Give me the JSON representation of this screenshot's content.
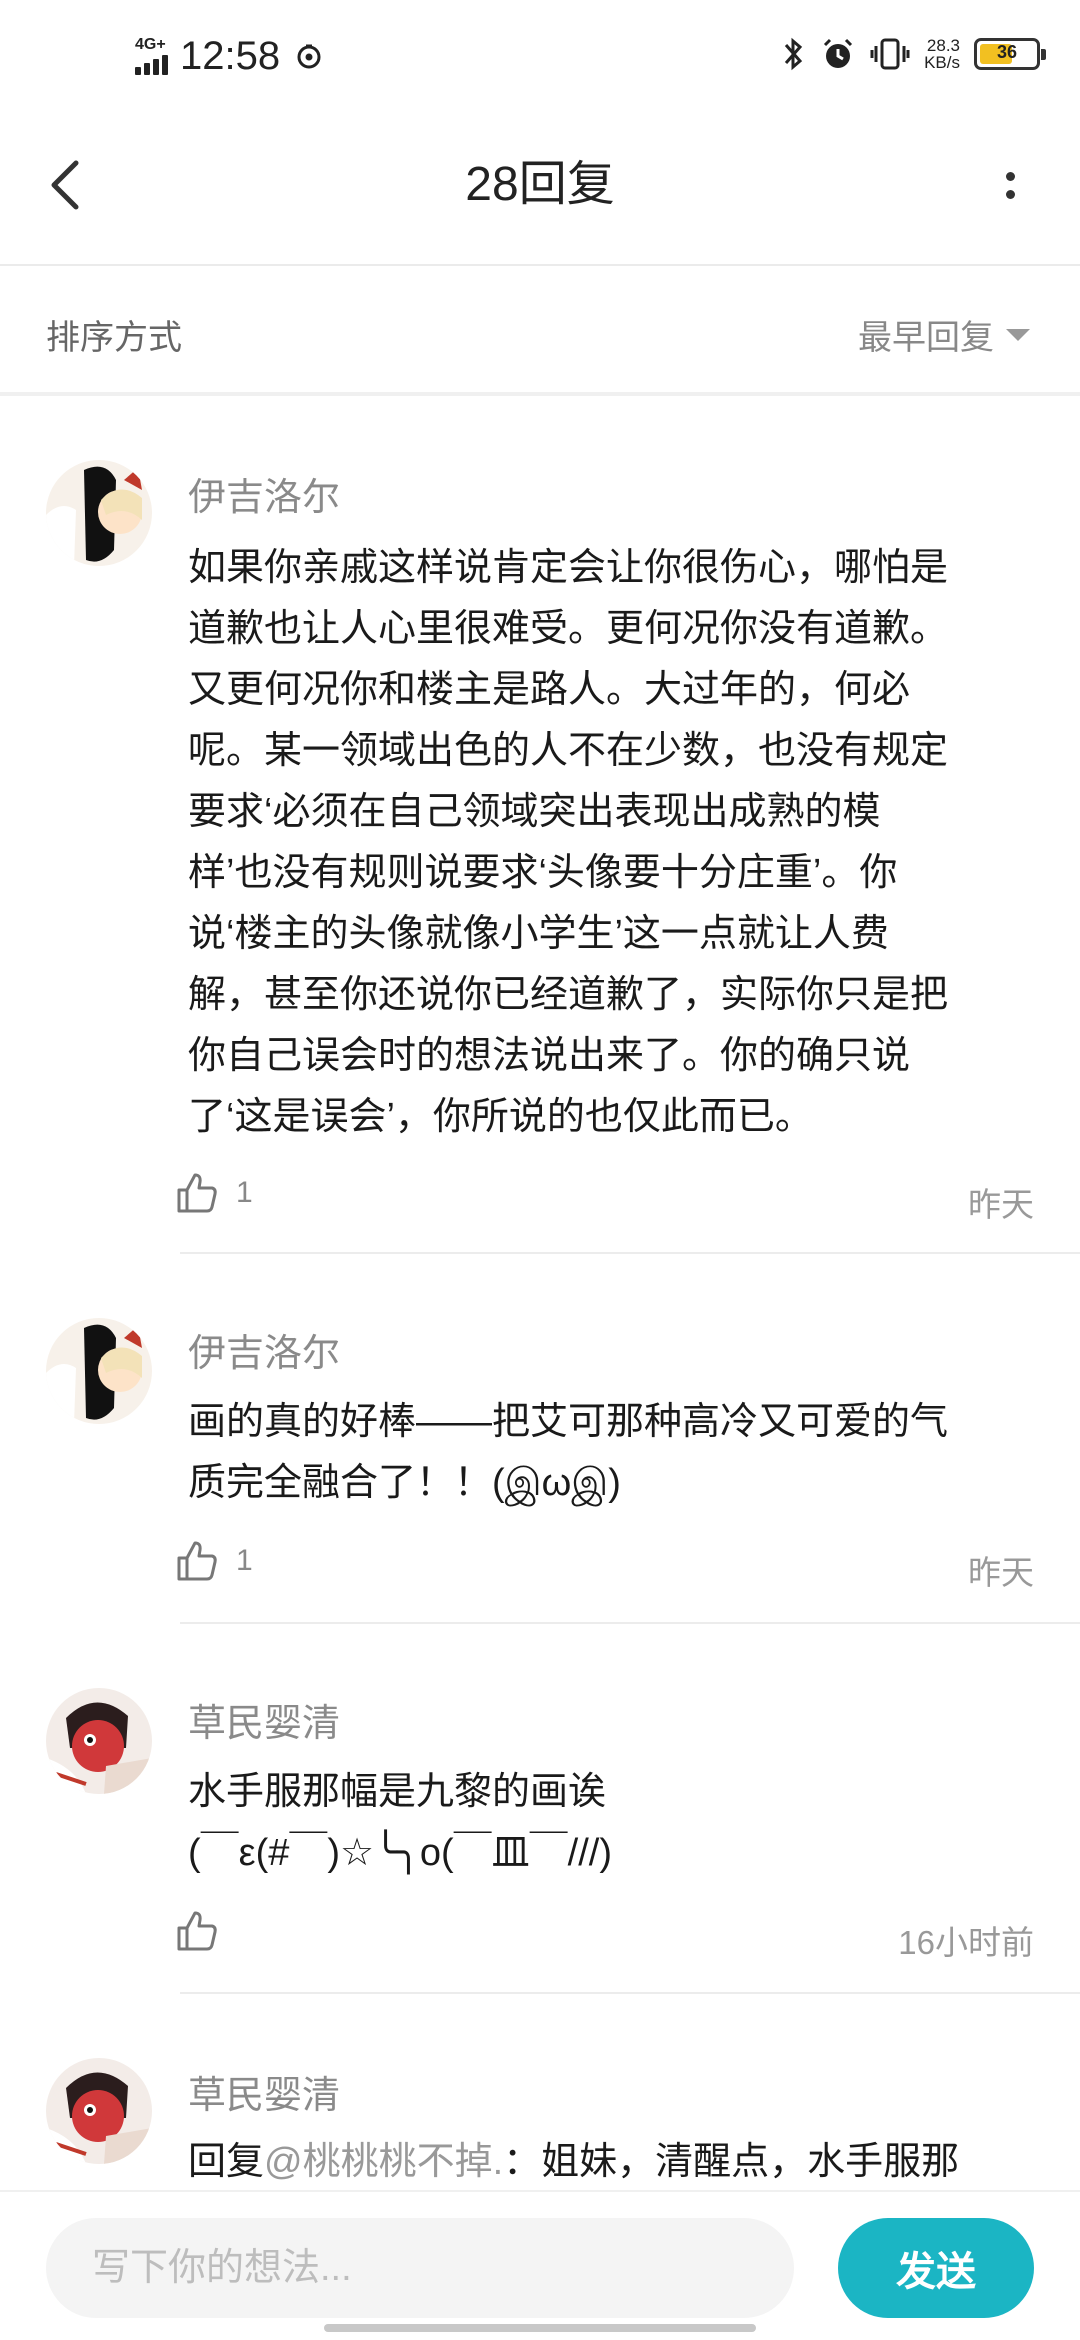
{
  "status_bar": {
    "network": "4G+",
    "time": "12:58",
    "speed_value": "28.3",
    "speed_unit": "KB/s",
    "battery": "36"
  },
  "header": {
    "title": "28回复"
  },
  "sort": {
    "label": "排序方式",
    "selected": "最早回复"
  },
  "comments": [
    {
      "author": "伊吉洛尔",
      "lines": [
        "如果你亲戚这样说肯定会让你很伤心，哪怕是",
        "道歉也让人心里很难受。更何况你没有道歉。",
        "又更何况你和楼主是路人。大过年的，何必",
        "呢。某一领域出色的人不在少数，也没有规定",
        "要求‘必须在自己领域突出表现出成熟的模",
        "样’也没有规则说要求‘头像要十分庄重’。你",
        "说‘楼主的头像就像小学生’这一点就让人费",
        "解，甚至你还说你已经道歉了，实际你只是把",
        "你自己误会时的想法说出来了。你的确只说",
        "了‘这是误会’，你所说的也仅此而已。"
      ],
      "likes": "1",
      "time": "昨天"
    },
    {
      "author": "伊吉洛尔",
      "lines": [
        "画的真的好棒——把艾可那种高冷又可爱的气",
        "质完全融合了！！(இωஇ)"
      ],
      "likes": "1",
      "time": "昨天"
    },
    {
      "author": "草民婴清",
      "lines": [
        "水手服那幅是九黎的画诶",
        "(￣ε(#￣)☆╰╮o(￣皿￣///)"
      ],
      "likes": "",
      "time": "16小时前"
    },
    {
      "author": "草民婴清",
      "reply_prefix": "回复",
      "mention": "@桃桃桃不掉.",
      "reply_text": "：姐妹，清醒点，水手服那"
    }
  ],
  "input": {
    "placeholder": "写下你的想法...",
    "send_label": "发送"
  },
  "colors": {
    "accent": "#1bb5c4",
    "name_gray": "#8a8a8a"
  }
}
